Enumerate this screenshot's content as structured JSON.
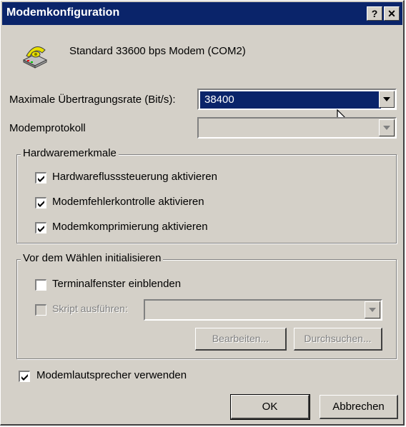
{
  "window": {
    "title": "Modemkonfiguration",
    "help_label": "?",
    "close_label": "✕"
  },
  "modem": {
    "name": "Standard 33600 bps Modem (COM2)",
    "icon": "telephone-modem-icon"
  },
  "rate": {
    "label": "Maximale Übertragungsrate (Bit/s):",
    "value": "38400"
  },
  "protocol": {
    "label": "Modemprotokoll",
    "value": ""
  },
  "hardware": {
    "legend": "Hardwaremerkmale",
    "items": [
      {
        "label": "Hardwareflusssteuerung aktivieren",
        "checked": true
      },
      {
        "label": "Modemfehlerkontrolle aktivieren",
        "checked": true
      },
      {
        "label": "Modemkomprimierung aktivieren",
        "checked": true
      }
    ]
  },
  "init": {
    "legend": "Vor dem Wählen initialisieren",
    "terminal_label": "Terminalfenster einblenden",
    "terminal_checked": false,
    "script_label": "Skript ausführen:",
    "script_checked": false,
    "script_value": "",
    "edit_label": "Bearbeiten...",
    "browse_label": "Durchsuchen..."
  },
  "speaker": {
    "label": "Modemlautsprecher verwenden",
    "checked": true
  },
  "buttons": {
    "ok": "OK",
    "cancel": "Abbrechen"
  }
}
